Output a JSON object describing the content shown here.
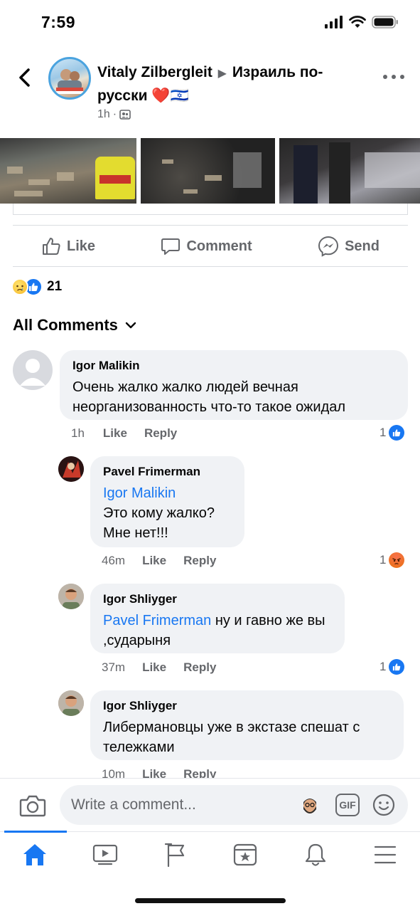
{
  "status_bar": {
    "time": "7:59"
  },
  "post": {
    "author": "Vitaly Zilbergleit",
    "group": "Израиль по-русски",
    "group_emoji": "❤️🇮🇱",
    "time": "1h",
    "separator": "·"
  },
  "actions": {
    "like": "Like",
    "comment": "Comment",
    "send": "Send"
  },
  "reactions": {
    "count": "21"
  },
  "comments_header": {
    "label": "All Comments"
  },
  "comments": [
    {
      "name": "Igor Malikin",
      "mention": "",
      "text": "Очень жалко жалко людей вечная неорганизованность что-то такое ожидал",
      "time": "1h",
      "like": "Like",
      "reply": "Reply",
      "reaction_count": "1"
    },
    {
      "name": "Pavel Frimerman",
      "mention": "Igor Malikin",
      "text": "Это кому жалко? Мне нет!!!",
      "time": "46m",
      "like": "Like",
      "reply": "Reply",
      "reaction_count": "1"
    },
    {
      "name": "Igor Shliyger",
      "mention": "Pavel Frimerman",
      "text": " ну и гавно же вы ,сударыня",
      "time": "37m",
      "like": "Like",
      "reply": "Reply",
      "reaction_count": "1"
    },
    {
      "name": "Igor Shliyger",
      "mention": "",
      "text": "Либермановцы уже в экстазе спешат с тележками",
      "time": "10m",
      "like": "Like",
      "reply": "Reply"
    }
  ],
  "composer": {
    "placeholder": "Write a comment...",
    "gif_label": "GIF"
  },
  "tabbar": {
    "items": [
      "home-icon",
      "watch-icon",
      "pages-icon",
      "feeds-icon",
      "notifications-icon",
      "menu-icon"
    ]
  },
  "colors": {
    "accent": "#1877f2",
    "bubble": "#f0f2f5",
    "secondary_text": "#65676b"
  }
}
